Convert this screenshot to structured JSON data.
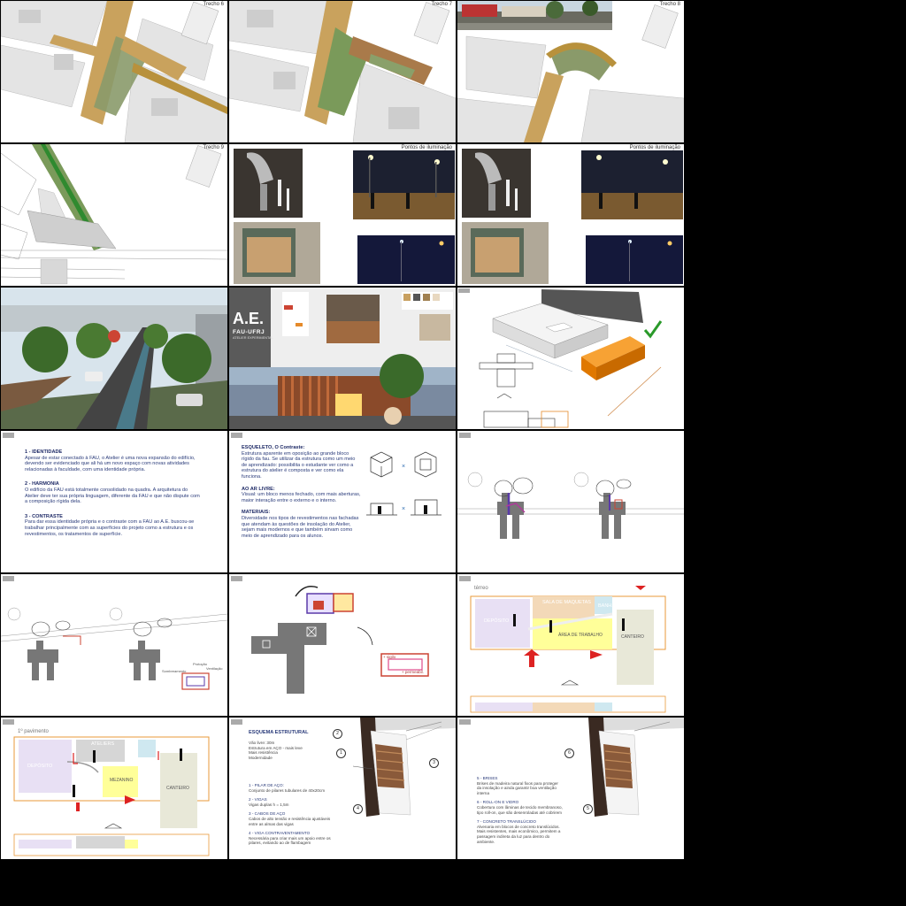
{
  "row1": {
    "s1_title": "Trecho 6",
    "s2_title": "Trecho 7",
    "s3_title": "Trecho 8"
  },
  "row2": {
    "s4_title": "Trecho 9",
    "s5_title": "Pontos de iluminação",
    "s6_title": "Pontos de iluminação"
  },
  "ae": {
    "big": "A.E.",
    "sub": "FAU-UFRJ",
    "sub2": "ATELIER EXPERIMENTAL"
  },
  "principles": {
    "p1_title": "1 - IDENTIDADE",
    "p1_text": "Apesar de estar conectado à FAU, o Atelier é uma nova expansão do edifício, devendo ser evidenciado que ali há um novo espaço com novas atividades relacionadas à faculdade, com uma identidade própria.",
    "p2_title": "2 - HARMONIA",
    "p2_text": "O edifício da FAU está totalmente consolidado na quadra. A arquitetura do Atelier deve ter sua própria linguagem, diferente da FAU e que não dispute com a composição rígida dela.",
    "p3_title": "3 - CONTRASTE",
    "p3_text": "Para dar essa identidade própria e o contraste com a FAU ao A.E. buscou-se trabalhar principalmente com as superfícies do projeto como a estrutura e os revestimentos, os tratamentos de superfície."
  },
  "concepts": {
    "c1_title": "ESQUELETO, O Contraste:",
    "c1_text": "Estrutura aparente em oposição ao grande bloco rígido da fau. Se utilizar da estrutura como um meio de aprendizado: possibilita o estudante ver como a estrutura do atelier é composta e ver como ela funciona.",
    "c2_title": "AO AR LIVRE:",
    "c2_text": "Visual: um bloco menos fechado, com mais aberturas, maior interação entre o externo e o interno.",
    "c3_title": "MATERIAIS:",
    "c3_text": "Diversidade nos tipos de revestimentos nas fachadas que atendam às questões de insolação do Atelier, sejam mais modernos e que também sirvam como meio de aprendizado para os alunos."
  },
  "plan1": {
    "label": "térreo",
    "sala": "SALA DE MAQUETAS",
    "banh": "BANH.",
    "deposito": "DEPÓSITO",
    "area": "ÁREA DE TRABALHO",
    "canteiro": "CANTEIRO"
  },
  "plan2": {
    "label": "1º pavimento",
    "deposito": "DEPÓSITO",
    "ateliers": "ATELIERS",
    "mezanino": "MEZANINO",
    "canteiro": "CANTEIRO"
  },
  "struct": {
    "title": "ESQUEMA ESTRUTURAL",
    "intro": [
      "Vão livre: 30m",
      "Estrutura em AÇO - mais leve",
      "Mais resistência",
      "Modernidade"
    ],
    "i1": "1 - PILAR DE AÇO:",
    "i1t": "Conjunto de pilares tubulares de 40x20cm",
    "i2": "2 - VIGAS",
    "i2t": "Vigas duplas h = 1,5m",
    "i3": "3 - CABOS DE AÇO",
    "i3t": "Cabos de alto tensão e resistência ajustáveis entre as almas das vigas",
    "i4": "4 - VIGA CONTRAVENTAMENTO",
    "i4t": "Necessária para criar mais um apoio entre os pilares, evitando ao de flambagem"
  },
  "struct2": {
    "i5": "5 - BRISES",
    "i5t": "Brises de madeira natural fixos para proteger da insolação e ainda garantir boa ventilação interna",
    "i6": "6 - ROLL-ON E VIDRO",
    "i6t": "Cobertura com lâminas de tecido membranoso, tipo roll-on, que são desenroladas até cobrirem",
    "i7": "7 - CONCRETO TRANSLÚCIDO",
    "i7t": "Alvenaria em blocos de concreto translúcidos. Mais resistentes, mais econômico, permitem a passagem indireta da luz para dentro do ambiente."
  },
  "diagram_labels": {
    "d1": "+ sigilo",
    "d2": "+ permeabil.",
    "d3": "Protoção",
    "d4": "Ventilação",
    "d5": "Sombreamento"
  },
  "colors": {
    "accent_orange": "#f07b00",
    "check_green": "#2a9a2a",
    "plan_orange": "#e89a3a",
    "text_blue": "#2a3b7a"
  }
}
